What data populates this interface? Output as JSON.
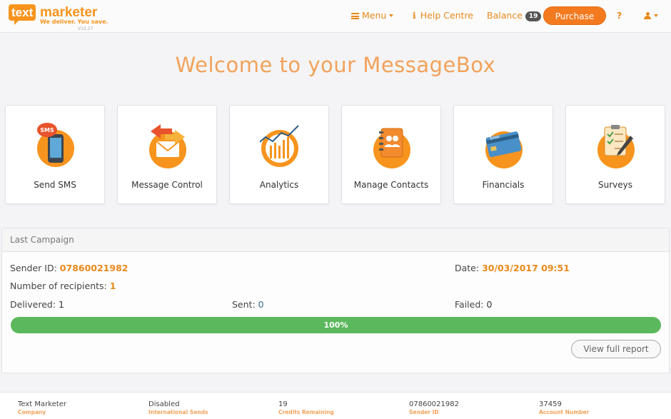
{
  "header": {
    "logo": {
      "word1": "text",
      "word2": "marketer",
      "tagline": "We deliver. You save.",
      "version": "V12.27"
    },
    "menu_label": "Menu",
    "help_label": "Help Centre",
    "balance_label": "Balance",
    "balance_count": "19",
    "purchase_label": "Purchase",
    "question_label": "?"
  },
  "page_title": "Welcome to your MessageBox",
  "tiles": [
    {
      "label": "Send SMS",
      "icon": "sms-phone-icon"
    },
    {
      "label": "Message Control",
      "icon": "message-control-icon"
    },
    {
      "label": "Analytics",
      "icon": "analytics-icon"
    },
    {
      "label": "Manage Contacts",
      "icon": "contacts-book-icon"
    },
    {
      "label": "Financials",
      "icon": "bank-card-icon"
    },
    {
      "label": "Surveys",
      "icon": "survey-clipboard-icon"
    }
  ],
  "campaign": {
    "heading": "Last Campaign",
    "sender_id_label": "Sender ID:",
    "sender_id": "07860021982",
    "date_label": "Date:",
    "date": "30/03/2017 09:51",
    "recipients_label": "Number of recipients:",
    "recipients": "1",
    "delivered_label": "Delivered:",
    "delivered": "1",
    "sent_label": "Sent:",
    "sent": "0",
    "failed_label": "Failed:",
    "failed": "0",
    "progress_text": "100%",
    "progress_fraction": 1.0,
    "report_button": "View full report"
  },
  "footer": [
    {
      "value": "Text Marketer",
      "label": "Company"
    },
    {
      "value": "Disabled",
      "label": "International Sends"
    },
    {
      "value": "19",
      "label": "Credits Remaining"
    },
    {
      "value": "07860021982",
      "label": "Sender ID"
    },
    {
      "value": "37459",
      "label": "Account Number"
    }
  ],
  "colors": {
    "accent": "#f47a1f",
    "title": "#f2a25a",
    "progress": "#5cb85c"
  }
}
